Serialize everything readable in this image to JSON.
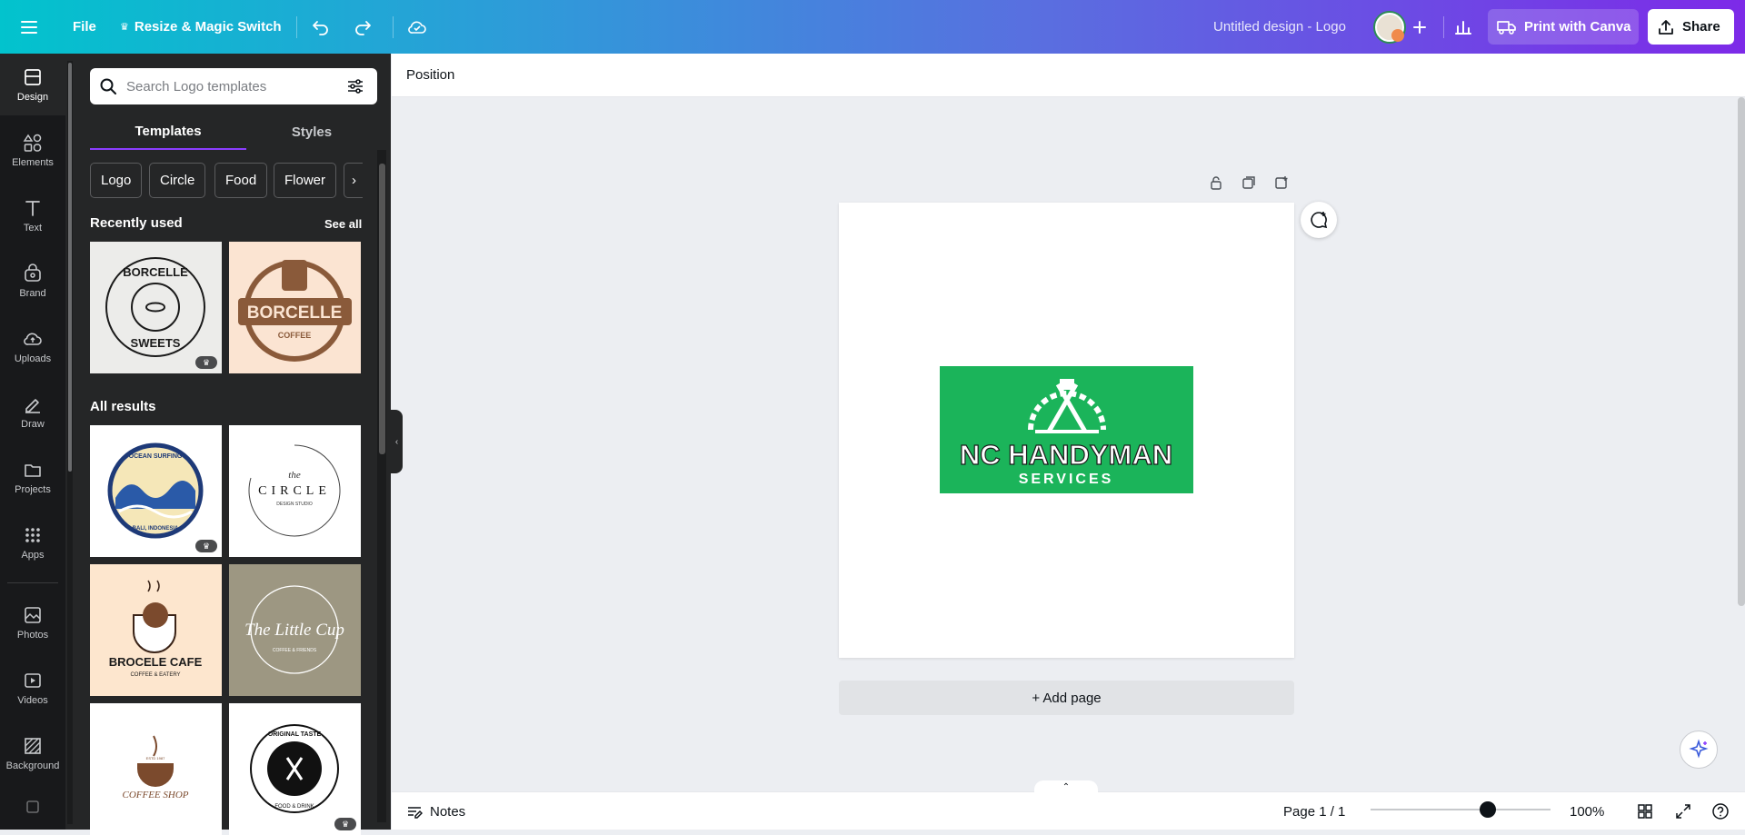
{
  "topbar": {
    "file_label": "File",
    "resize_label": "Resize & Magic Switch",
    "title": "Untitled design - Logo",
    "print_label": "Print with Canva",
    "share_label": "Share"
  },
  "rail": {
    "items": [
      {
        "label": "Design",
        "icon": "design-icon"
      },
      {
        "label": "Elements",
        "icon": "elements-icon"
      },
      {
        "label": "Text",
        "icon": "text-icon"
      },
      {
        "label": "Brand",
        "icon": "brand-icon"
      },
      {
        "label": "Uploads",
        "icon": "uploads-icon"
      },
      {
        "label": "Draw",
        "icon": "draw-icon"
      },
      {
        "label": "Projects",
        "icon": "projects-icon"
      },
      {
        "label": "Apps",
        "icon": "apps-icon"
      },
      {
        "label": "Photos",
        "icon": "photos-icon"
      },
      {
        "label": "Videos",
        "icon": "videos-icon"
      },
      {
        "label": "Background",
        "icon": "background-icon"
      }
    ]
  },
  "panel": {
    "search_placeholder": "Search Logo templates",
    "tabs": [
      "Templates",
      "Styles"
    ],
    "chips": [
      "Logo",
      "Circle",
      "Food",
      "Flower"
    ],
    "recent_title": "Recently used",
    "see_all": "See all",
    "all_results_title": "All results",
    "recent": [
      {
        "name": "BORCELLE SWEETS",
        "line1": "BORCELLE",
        "line2": "SWEETS"
      },
      {
        "name": "BORCELLE COFFEE",
        "line1": "BORCELLE",
        "line2": "COFFEE"
      }
    ],
    "results": [
      {
        "name": "OCEAN SURFING",
        "line1": "OCEAN SURFING",
        "line2": "BALI, INDONESIA"
      },
      {
        "name": "THE CIRCLE",
        "line1": "CIRCLE",
        "line2": "DESIGN STUDIO",
        "line0": "the"
      },
      {
        "name": "BROCELE CAFE",
        "line1": "BROCELE CAFE",
        "line2": "COFFEE & EATERY"
      },
      {
        "name": "The Little Cup",
        "line1": "The Little Cup",
        "line2": "COFFEE & FRIENDS"
      },
      {
        "name": "COFFEE SHOP",
        "line1": "COFFEE SHOP",
        "line2": "ESTD 1987"
      },
      {
        "name": "ORIGINAL TASTE",
        "line1": "ORIGINAL TASTE",
        "line2": "FOOD & DRINK"
      }
    ]
  },
  "editor": {
    "position_label": "Position",
    "add_page_label": "+ Add page",
    "logo": {
      "title": "NC HANDYMAN",
      "subtitle": "SERVICES",
      "bg": "#1bb45a"
    }
  },
  "bottombar": {
    "notes_label": "Notes",
    "page_label": "Page 1 / 1",
    "zoom_label": "100%",
    "zoom_level": 0.65
  },
  "colors": {
    "accent": "#8b3dff",
    "dark_panel": "#252627",
    "rail": "#18191b"
  }
}
